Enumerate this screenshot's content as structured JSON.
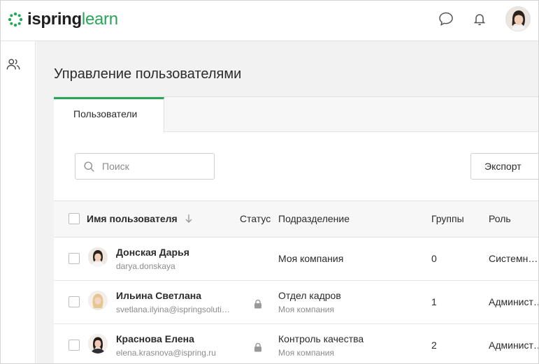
{
  "brand": {
    "name_part1": "ispring",
    "name_part2": "learn",
    "color": "#27a65a"
  },
  "header": {
    "icons": [
      "chat-icon",
      "bell-icon"
    ]
  },
  "sidebar": {
    "items": [
      {
        "icon": "users-icon"
      }
    ]
  },
  "page": {
    "title": "Управление пользователями"
  },
  "tabs": [
    {
      "label": "Пользователи",
      "active": true
    }
  ],
  "toolbar": {
    "search_placeholder": "Поиск",
    "export_label": "Экспорт"
  },
  "table": {
    "columns": {
      "name": "Имя пользователя",
      "status": "Статус",
      "department": "Подразделение",
      "groups": "Группы",
      "role": "Роль"
    },
    "rows": [
      {
        "name": "Донская Дарья",
        "login": "darya.donskaya",
        "locked": false,
        "department": "Моя компания",
        "department_parent": "",
        "groups": "0",
        "role": "Системный администратор"
      },
      {
        "name": "Ильина Светлана",
        "login": "svetlana.ilyina@ispringsolutions.com",
        "locked": true,
        "department": "Отдел кадров",
        "department_parent": "Моя компания",
        "groups": "1",
        "role": "Администратор"
      },
      {
        "name": "Краснова Елена",
        "login": "elena.krasnova@ispring.ru",
        "locked": true,
        "department": "Контроль качества",
        "department_parent": "Моя компания",
        "groups": "2",
        "role": "Администратор"
      }
    ]
  }
}
